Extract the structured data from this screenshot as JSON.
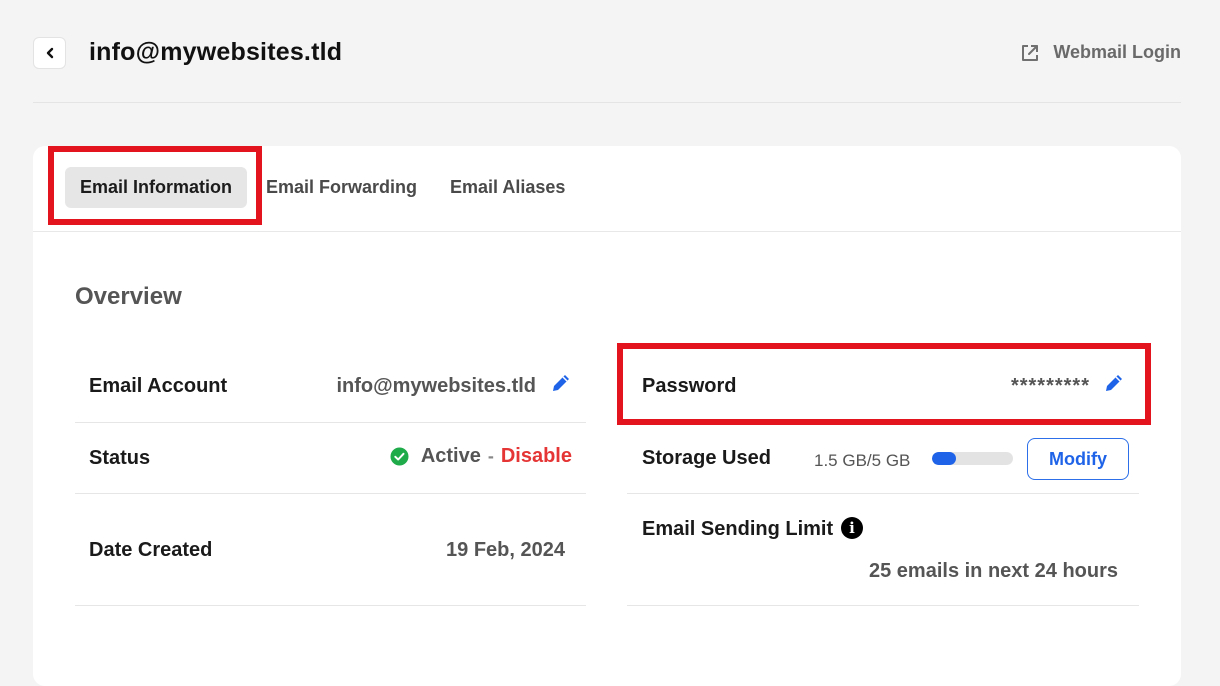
{
  "header": {
    "title": "info@mywebsites.tld",
    "webmail_label": "Webmail Login"
  },
  "tabs": [
    {
      "label": "Email Information",
      "active": true
    },
    {
      "label": "Email Forwarding",
      "active": false
    },
    {
      "label": "Email Aliases",
      "active": false
    }
  ],
  "overview": {
    "heading": "Overview",
    "email_account": {
      "label": "Email Account",
      "value": "info@mywebsites.tld"
    },
    "status": {
      "label": "Status",
      "active": "Active",
      "separator": "-",
      "disable": "Disable"
    },
    "date_created": {
      "label": "Date Created",
      "value": "19 Feb, 2024"
    },
    "password": {
      "label": "Password",
      "value": "*********"
    },
    "storage": {
      "label": "Storage Used",
      "value": "1.5 GB/5 GB",
      "used_fraction": 0.3,
      "modify_label": "Modify"
    },
    "sending_limit": {
      "label": "Email Sending Limit",
      "value": "25 emails in next 24 hours"
    }
  },
  "colors": {
    "accent": "#1f64e8",
    "highlight": "#e3141e",
    "active_green": "#1fab4a",
    "disable_red": "#e53535"
  },
  "icons": [
    "chevron-left-icon",
    "external-link-icon",
    "pencil-icon",
    "check-circle-icon",
    "info-icon"
  ]
}
